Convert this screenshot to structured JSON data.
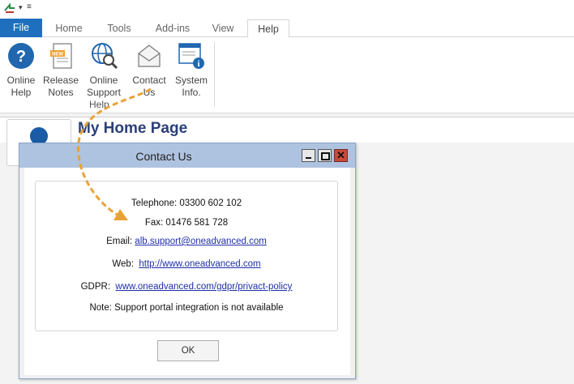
{
  "ribbon_tabs": {
    "file": "File",
    "home": "Home",
    "tools": "Tools",
    "addins": "Add-ins",
    "view": "View",
    "help": "Help"
  },
  "ribbon": {
    "buttons": {
      "online_help": [
        "Online",
        "Help"
      ],
      "release_notes": [
        "Release",
        "Notes"
      ],
      "online_support": [
        "Online",
        "Support"
      ],
      "contact_us": [
        "Contact",
        "Us"
      ],
      "system_info": [
        "System",
        "Info."
      ]
    },
    "new_badge": "NEW",
    "group_label": "Help"
  },
  "home_page": {
    "title": "My Home Page"
  },
  "dialog": {
    "title": "Contact Us",
    "close_glyph": "✕",
    "telephone": "Telephone: 03300 602 102",
    "fax": "Fax: 01476 581 728",
    "email_label": "Email:",
    "email_value": "alb.support@oneadvanced.com",
    "web_label": "Web:",
    "web_value": "http://www.oneadvanced.com",
    "gdpr_label": "GDPR:",
    "gdpr_value": "www.oneadvanced.com/gdpr/privact-policy",
    "note": "Note: Support portal integration is not available",
    "ok_label": "OK"
  },
  "colors": {
    "file_tab": "#1f6fbf",
    "dialog_titlebar": "#aec3e0",
    "link": "#1f2fa8",
    "arrow": "#e8a23a",
    "home_title": "#2b3f7a"
  }
}
